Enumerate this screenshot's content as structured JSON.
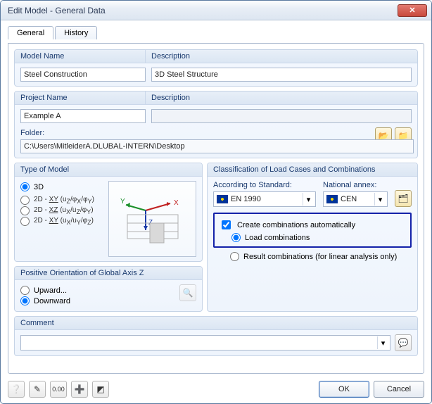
{
  "window": {
    "title": "Edit Model - General Data",
    "tabs": {
      "general": "General",
      "history": "History"
    }
  },
  "model_name": {
    "label": "Model Name",
    "value": "Steel Construction"
  },
  "model_desc": {
    "label": "Description",
    "value": "3D Steel Structure"
  },
  "project_name": {
    "label": "Project Name",
    "value": "Example A"
  },
  "project_desc": {
    "label": "Description",
    "value": ""
  },
  "folder": {
    "label": "Folder:",
    "value": "C:\\Users\\MitleiderA.DLUBAL-INTERN\\Desktop"
  },
  "type_of_model": {
    "title": "Type of Model",
    "options": {
      "threeD": "3D",
      "xy": "2D - XY (uz/φx/φY)",
      "xz": "2D - XZ (ux/uz/φY)",
      "xy_wall": "2D - XY (ux/uY/φz)"
    },
    "selected": "threeD"
  },
  "classification": {
    "title": "Classification of Load Cases and Combinations",
    "according": "According to Standard:",
    "annex": "National annex:",
    "standard_value": "EN 1990",
    "annex_value": "CEN",
    "create_auto": "Create combinations automatically",
    "load_comb": "Load combinations",
    "result_comb": "Result combinations (for linear analysis only)"
  },
  "orientation": {
    "title": "Positive Orientation of Global Axis Z",
    "upward": "Upward...",
    "downward": "Downward",
    "selected": "downward"
  },
  "comment": {
    "title": "Comment",
    "value": ""
  },
  "buttons": {
    "ok": "OK",
    "cancel": "Cancel"
  }
}
